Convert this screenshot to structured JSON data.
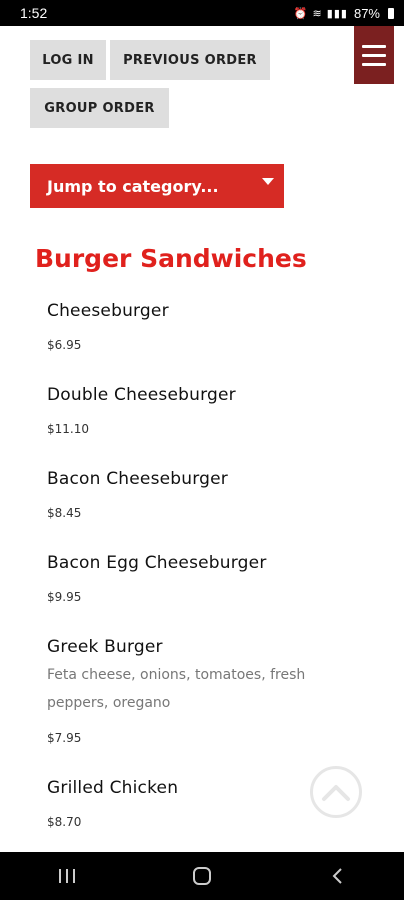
{
  "status_bar": {
    "time": "1:52",
    "icons": "⏰ ≋ ▮▮▮",
    "battery_text": "87%"
  },
  "header": {
    "login_label": "LOG IN",
    "previous_order_label": "PREVIOUS ORDER",
    "group_order_label": "GROUP ORDER"
  },
  "category_select": {
    "selected": "Jump to category..."
  },
  "section": {
    "title": "Burger Sandwiches"
  },
  "menu_items": [
    {
      "name": "Cheeseburger",
      "description": "",
      "price": "$6.95"
    },
    {
      "name": "Double Cheeseburger",
      "description": "",
      "price": "$11.10"
    },
    {
      "name": "Bacon Cheeseburger",
      "description": "",
      "price": "$8.45"
    },
    {
      "name": "Bacon Egg Cheeseburger",
      "description": "",
      "price": "$9.95"
    },
    {
      "name": "Greek Burger",
      "description": "Feta cheese, onions, tomatoes, fresh peppers, oregano",
      "price": "$7.95"
    },
    {
      "name": "Grilled Chicken",
      "description": "",
      "price": "$8.70"
    }
  ],
  "colors": {
    "accent_red": "#d62b25",
    "title_red": "#e0211d",
    "menu_button": "#7b2020",
    "gray_button": "#dedede"
  }
}
